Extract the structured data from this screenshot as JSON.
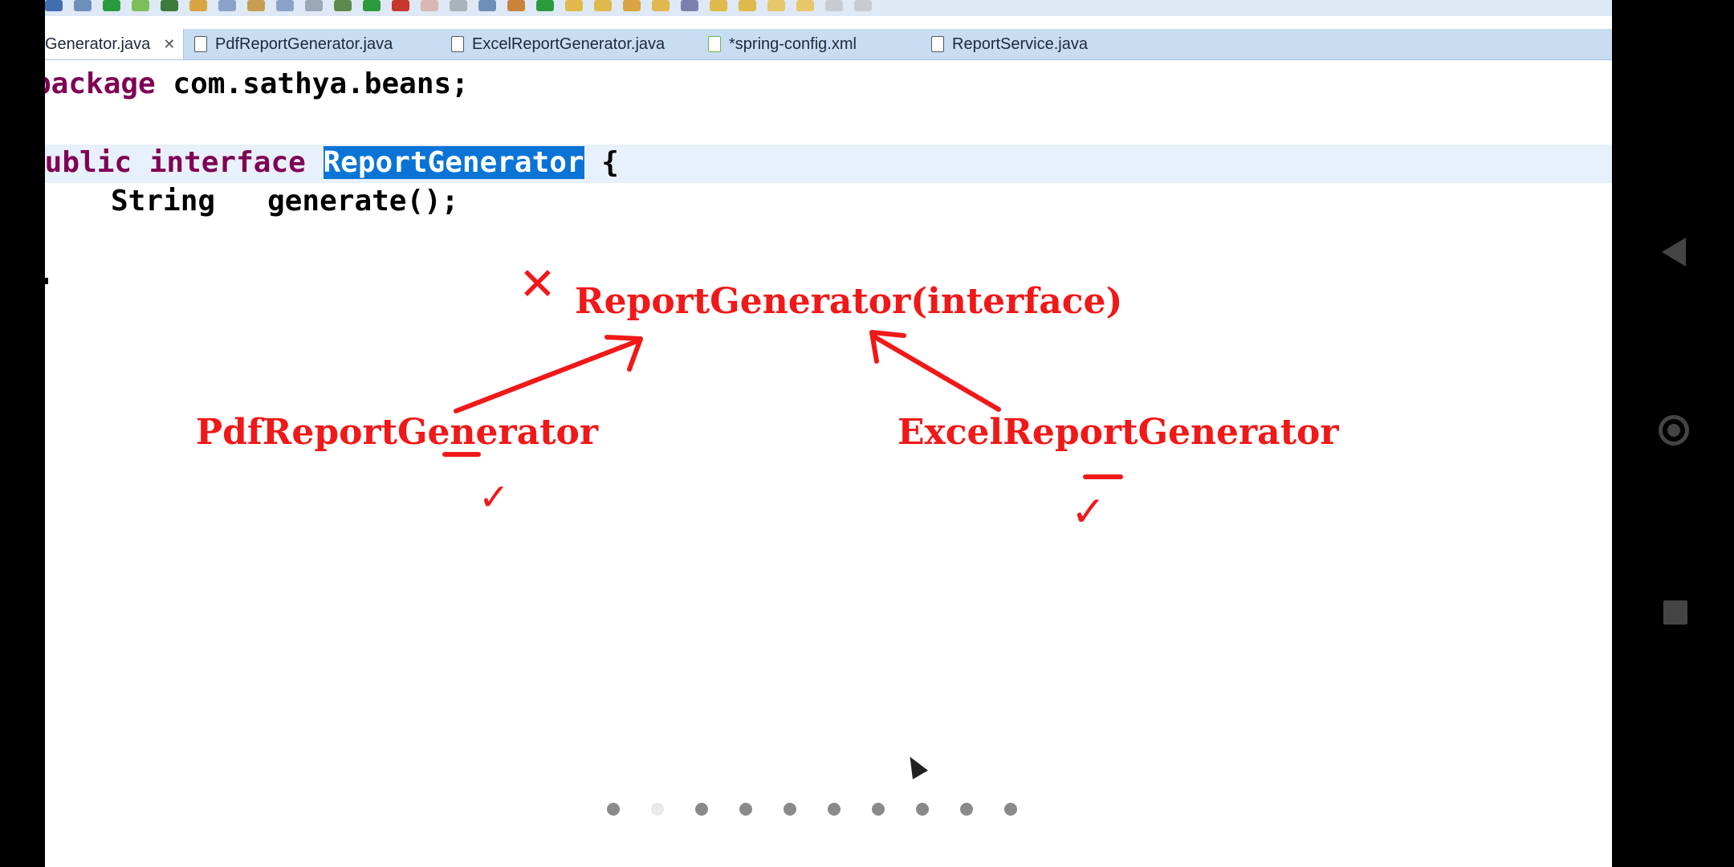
{
  "tabs": [
    {
      "label": "Generator.java",
      "type": "java",
      "active": true
    },
    {
      "label": "PdfReportGenerator.java",
      "type": "java",
      "active": false
    },
    {
      "label": "ExcelReportGenerator.java",
      "type": "java",
      "active": false
    },
    {
      "label": "*spring-config.xml",
      "type": "xml",
      "active": false
    },
    {
      "label": "ReportService.java",
      "type": "java",
      "active": false
    }
  ],
  "code": {
    "line1_kw": "package",
    "line1_rest": " com.sathya.beans;",
    "line2_kw1": "public",
    "line2_kw2": "interface",
    "line2_selected": "ReportGenerator",
    "line2_rest": " {",
    "line3_type": "String",
    "line3_rest": "   generate();"
  },
  "annotations": {
    "interface_label": "ReportGenerator(interface)",
    "left_impl": "PdfReportGenerator",
    "right_impl": "ExcelReportGenerator",
    "cross_mark": "✕",
    "check_mark": "✓"
  },
  "pager": {
    "total": 10,
    "active_index": 1
  },
  "colors": {
    "annotation_red": "#f01818",
    "keyword": "#7f0055",
    "selection": "#0a74d6",
    "tabbar": "#c9ddf2"
  },
  "nav": [
    "back-triangle-icon",
    "home-circle-icon",
    "recents-square-icon"
  ]
}
